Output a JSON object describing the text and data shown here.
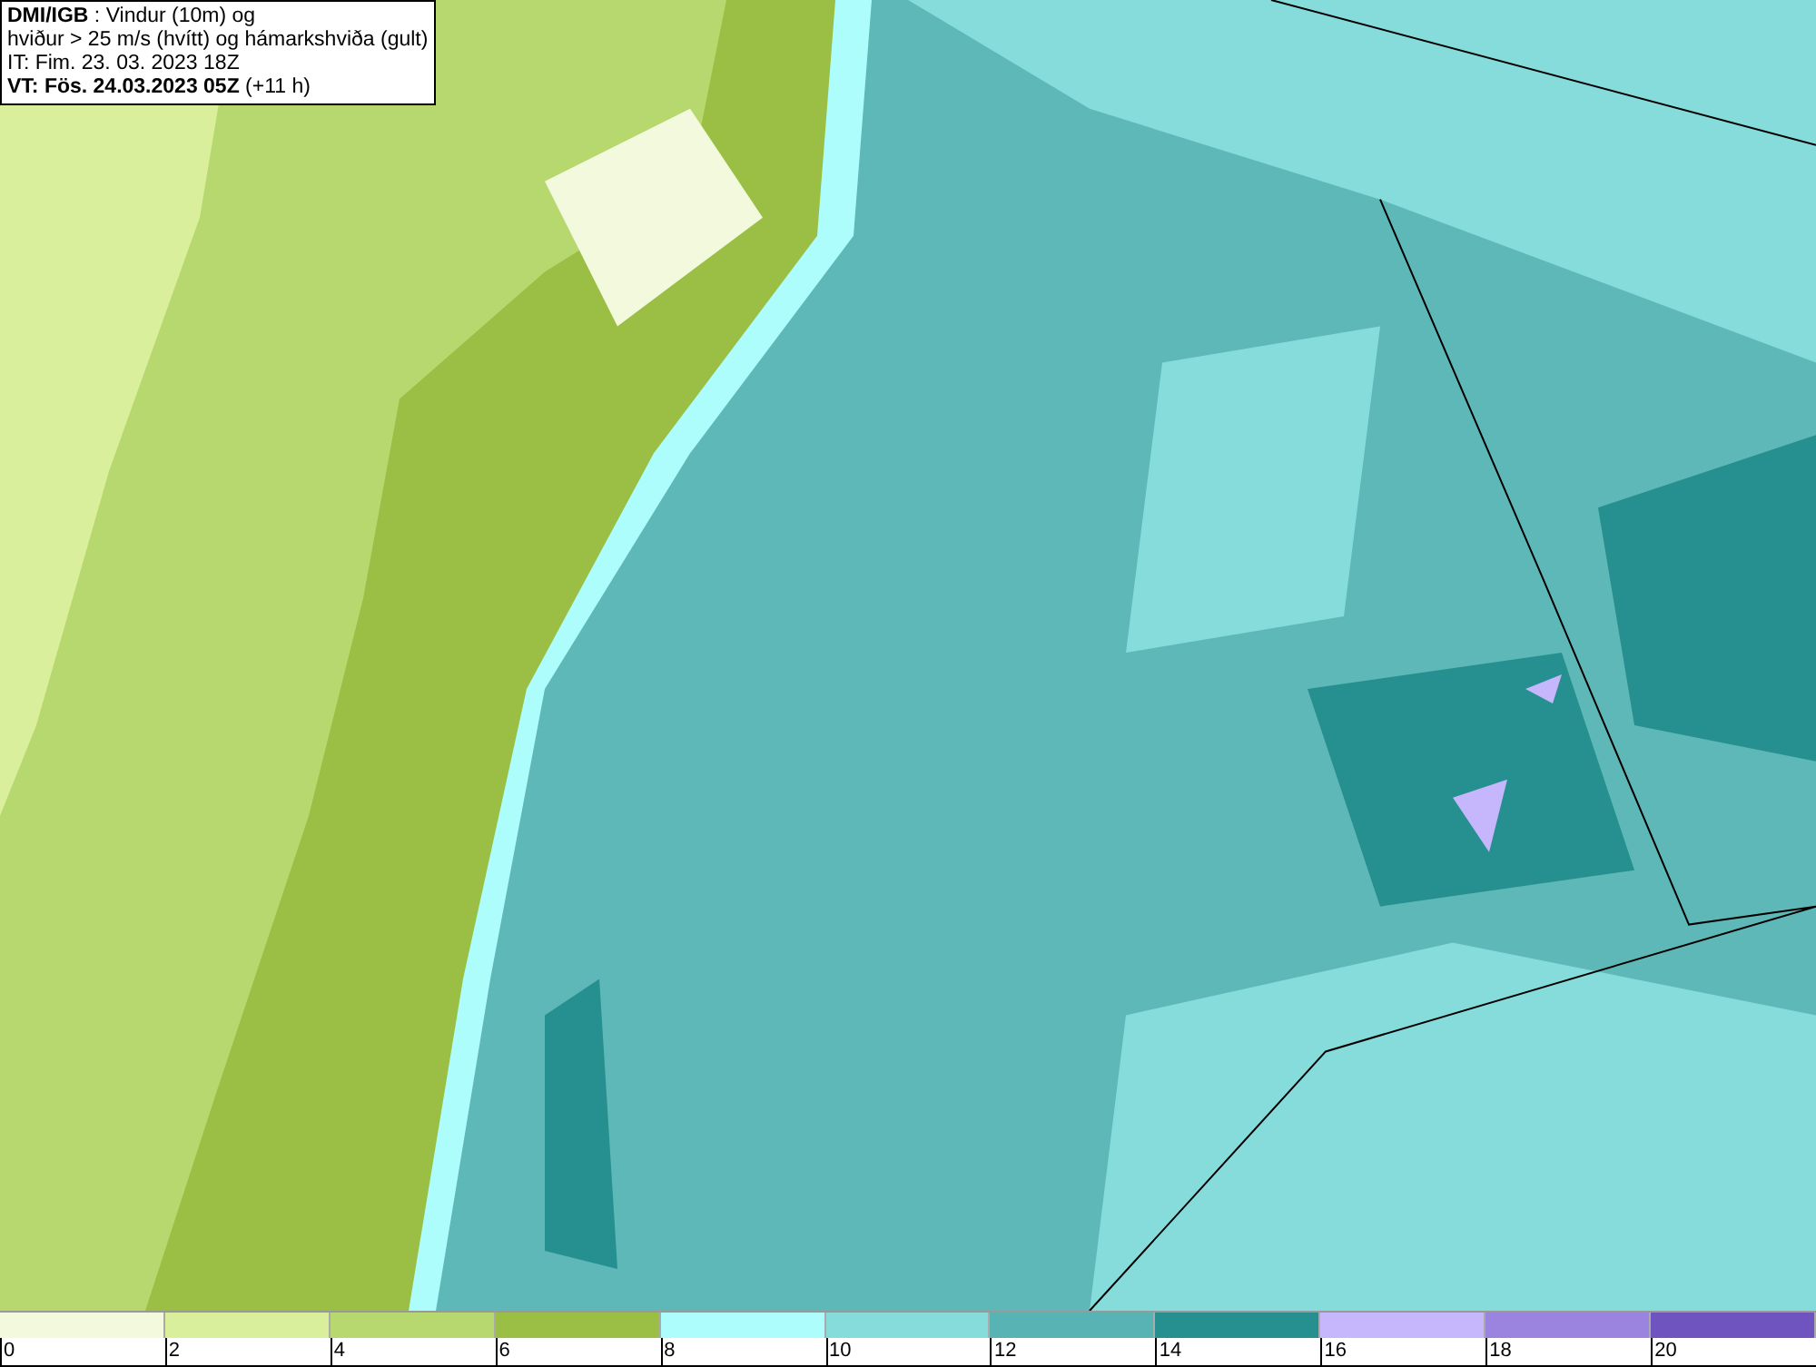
{
  "title_box": {
    "lines": [
      "**DMI/IGB** : Vindur (10m) og",
      "hviður > 25 m/s (hvítt) og hámarkshviða (gult)",
      "IT: Fim. 23. 03. 2023 18Z",
      "**VT: Fös. 24.03.2023 05Z** (+11 h)"
    ]
  },
  "legend": {
    "bins": [
      {
        "color": "#f3f9dc"
      },
      {
        "color": "#d9ef9b"
      },
      {
        "color": "#b7d86f"
      },
      {
        "color": "#9bbf45"
      },
      {
        "color": "#adfdfd"
      },
      {
        "color": "#86dbdb"
      },
      {
        "color": "#58b4b4"
      },
      {
        "color": "#268f8f"
      },
      {
        "color": "#c6b6fb"
      },
      {
        "color": "#9a84df"
      },
      {
        "color": "#6f53bf"
      }
    ],
    "ticks": [
      "0",
      "2",
      "4",
      "6",
      "8",
      "10",
      "12",
      "14",
      "16",
      "18",
      "20"
    ]
  }
}
